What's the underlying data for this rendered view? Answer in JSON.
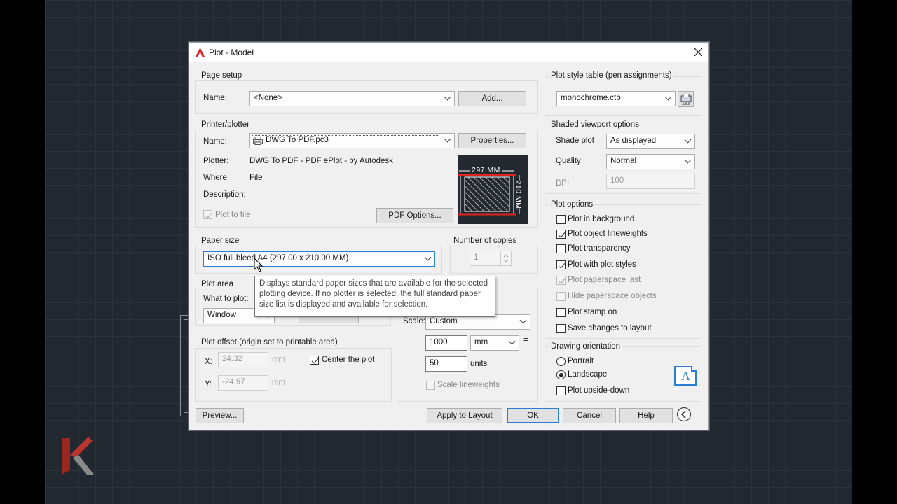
{
  "window": {
    "title": "Plot - Model"
  },
  "page_setup": {
    "group_label": "Page setup",
    "name_label": "Name:",
    "name_value": "<None>",
    "add_button": "Add..."
  },
  "printer": {
    "group_label": "Printer/plotter",
    "name_label": "Name:",
    "name_value": "DWG To PDF.pc3",
    "properties_button": "Properties...",
    "plotter_label": "Plotter:",
    "plotter_value": "DWG To PDF - PDF ePlot - by Autodesk",
    "where_label": "Where:",
    "where_value": "File",
    "description_label": "Description:",
    "plot_to_file": "Plot to file",
    "pdf_options_button": "PDF Options...",
    "preview_width": "297 MM",
    "preview_height": "210 MM"
  },
  "paper_size": {
    "group_label": "Paper size",
    "value": "ISO full bleed A4 (297.00 x 210.00 MM)"
  },
  "copies": {
    "group_label": "Number of copies",
    "value": "1"
  },
  "tooltip": {
    "text": "Displays standard paper sizes that are available for the selected plotting device. If no plotter is selected, the full standard paper size list is displayed and available for selection."
  },
  "plot_area": {
    "group_label": "Plot area",
    "what_label": "What to plot:",
    "what_value": "Window"
  },
  "plot_offset": {
    "group_label": "Plot offset (origin set to printable area)",
    "x_label": "X:",
    "x_value": "24.32",
    "x_unit": "mm",
    "y_label": "Y:",
    "y_value": "-24.97",
    "y_unit": "mm",
    "center_label": "Center the plot"
  },
  "plot_scale": {
    "scale_label": "Scale:",
    "scale_value": "Custom",
    "value1": "1000",
    "unit1": "mm",
    "equals": "=",
    "value2": "50",
    "unit2": "units",
    "scale_lineweights": "Scale lineweights"
  },
  "plot_style_table": {
    "group_label": "Plot style table (pen assignments)",
    "value": "monochrome.ctb"
  },
  "shaded_viewport": {
    "group_label": "Shaded viewport options",
    "shade_label": "Shade plot",
    "shade_value": "As displayed",
    "quality_label": "Quality",
    "quality_value": "Normal",
    "dpi_label": "DPI",
    "dpi_value": "100"
  },
  "plot_options": {
    "group_label": "Plot options",
    "items": [
      {
        "label": "Plot in background"
      },
      {
        "label": "Plot object lineweights"
      },
      {
        "label": "Plot transparency"
      },
      {
        "label": "Plot with plot styles"
      },
      {
        "label": "Plot paperspace last"
      },
      {
        "label": "Hide paperspace objects"
      },
      {
        "label": "Plot stamp on"
      },
      {
        "label": "Save changes to layout"
      }
    ]
  },
  "orientation": {
    "group_label": "Drawing orientation",
    "portrait": "Portrait",
    "landscape": "Landscape",
    "upside_down": "Plot upside-down",
    "icon_letter": "A"
  },
  "buttons": {
    "preview": "Preview...",
    "apply": "Apply to Layout",
    "ok": "OK",
    "cancel": "Cancel",
    "help": "Help"
  },
  "colors": {
    "accent": "#2a7fd4",
    "title_icon": "#d9262b",
    "canvas": "#212830"
  }
}
